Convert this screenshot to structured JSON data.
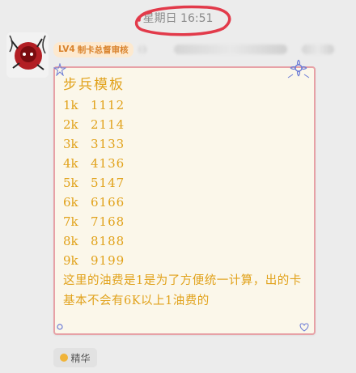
{
  "timestamp": "星期日 16:51",
  "sender": {
    "level": "LV4",
    "title": "制卡总督审核"
  },
  "note": {
    "heading": "步兵模板",
    "rows": [
      {
        "level": "1k",
        "value": "1112"
      },
      {
        "level": "2k",
        "value": "2114"
      },
      {
        "level": "3k",
        "value": "3133"
      },
      {
        "level": "4k",
        "value": "4136"
      },
      {
        "level": "5k",
        "value": "5147"
      },
      {
        "level": "6k",
        "value": "6166"
      },
      {
        "level": "7k",
        "value": "7168"
      },
      {
        "level": "8k",
        "value": "8188"
      },
      {
        "level": "9k",
        "value": "9199"
      }
    ],
    "paragraph": "这里的油费是1是为了方便统一计算，出的卡基本不会有6K以上1油费的"
  },
  "essence_label": "精华",
  "colors": {
    "handwriting": "#e1a21b",
    "bubble_border": "#e7a1a6",
    "circle_annotation": "#e23a4a",
    "badge_text": "#d9822b"
  }
}
